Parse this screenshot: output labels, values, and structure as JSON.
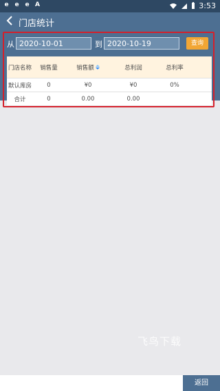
{
  "status": {
    "left_icons": [
      "e",
      "e",
      "e",
      "A"
    ],
    "time": "3:53"
  },
  "header": {
    "title": "门店统计"
  },
  "filter": {
    "from_label": "从",
    "start_date": "2020-10-01",
    "to_label": "到",
    "end_date": "2020-10-19",
    "query_button": "查询"
  },
  "table": {
    "headers": [
      "门店名称",
      "销售量",
      "销售额",
      "总利润",
      "总利率"
    ],
    "rows": [
      [
        "默认库房",
        "0",
        "¥0",
        "¥0",
        "0%"
      ],
      [
        "合计",
        "0",
        "0.00",
        "0.00",
        ""
      ]
    ]
  },
  "watermark": "飞鸟下载",
  "footer": {
    "return_button": "返回"
  },
  "colors": {
    "status_bar": "#2e4863",
    "app_bar": "#4d6f92",
    "query_button": "#f2a635",
    "header_row": "#fff3df",
    "highlight_box": "#d51f2a"
  }
}
